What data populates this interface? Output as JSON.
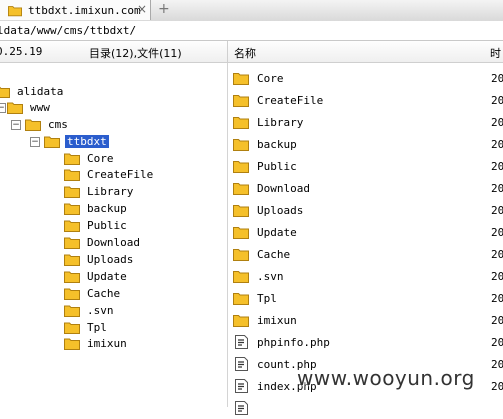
{
  "tab": {
    "title": "ttbdxt.imixun.com",
    "close_glyph": "×",
    "new_tab_glyph": "+"
  },
  "address": {
    "path": "ldata/www/cms/ttbdxt/"
  },
  "header": {
    "date": "0.25.19",
    "counts": "目录(12),文件(11)",
    "name_column": "名称",
    "time_column": "时"
  },
  "tree": {
    "root": "alidata",
    "www": "www",
    "cms": "cms",
    "selected": "ttbdxt",
    "children": [
      "Core",
      "CreateFile",
      "Library",
      "backup",
      "Public",
      "Download",
      "Uploads",
      "Update",
      "Cache",
      ".svn",
      "Tpl",
      "imixun"
    ],
    "expander_glyph": "−"
  },
  "list": {
    "folders": [
      "Core",
      "CreateFile",
      "Library",
      "backup",
      "Public",
      "Download",
      "Uploads",
      "Update",
      "Cache",
      ".svn",
      "Tpl",
      "imixun"
    ],
    "files": [
      "phpinfo.php",
      "count.php",
      "index.php"
    ],
    "time_prefix": "20"
  },
  "watermark": "www.wooyun.org",
  "colors": {
    "folder": "#f5c02a",
    "selection": "#2b5dcd",
    "tab_bg": "#fbfbfb"
  }
}
